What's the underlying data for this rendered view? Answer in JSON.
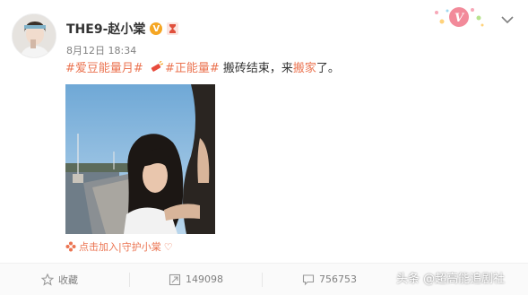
{
  "post": {
    "username": "THE9-赵小棠",
    "verified_badge": "V",
    "timestamp": "8月12日 18:34",
    "topic_1": "#爱豆能量月#",
    "topic_2": "#正能量#",
    "text_middle": " 搬砖结束，来",
    "keyword": "搬家",
    "text_end": "了。",
    "guard_label": "点击加入|守护小棠",
    "guard_suffix": "♡",
    "decoration_letter": "V"
  },
  "actions": {
    "favorite_label": "收藏",
    "repost_count": "149098",
    "comment_count": "756753"
  },
  "watermark": "头条 @超高能追剧社",
  "colors": {
    "accent": "#eb7350",
    "badge_gold": "#f5a623",
    "meta_gray": "#808080"
  }
}
